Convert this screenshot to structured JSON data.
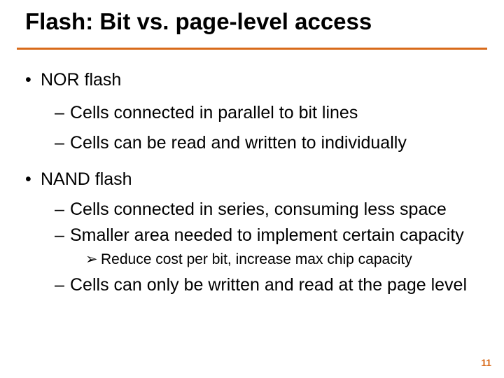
{
  "title": "Flash: Bit vs. page-level access",
  "bullets": {
    "nor": {
      "label": "NOR flash",
      "sub1": "Cells connected in parallel to bit lines",
      "sub2": "Cells can be read and written to individually"
    },
    "nand": {
      "label": "NAND flash",
      "sub1": "Cells connected in series, consuming less space",
      "sub2": "Smaller area needed to implement certain capacity",
      "sub2a": "Reduce cost per bit, increase max chip capacity",
      "sub3": "Cells can only be written and read at the page level"
    }
  },
  "glyphs": {
    "dot": "•",
    "dash": "–",
    "tri": "➢"
  },
  "pagenum": "11"
}
